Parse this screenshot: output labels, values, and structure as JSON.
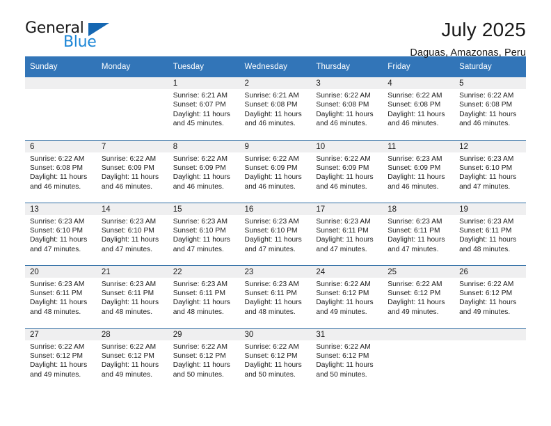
{
  "brand": {
    "name_part1": "General",
    "name_part2": "Blue",
    "triangle_color": "#1567b2",
    "blue_color": "#1a85d6"
  },
  "header": {
    "title": "July 2025",
    "location": "Daguas, Amazonas, Peru"
  },
  "theme": {
    "header_bg": "#3275b8",
    "row_divider": "#2e6da4",
    "num_band_bg": "#efeff0"
  },
  "weekday_headers": [
    "Sunday",
    "Monday",
    "Tuesday",
    "Wednesday",
    "Thursday",
    "Friday",
    "Saturday"
  ],
  "weeks": [
    [
      {
        "day": "",
        "sunrise": "",
        "sunset": "",
        "daylight1": "",
        "daylight2": ""
      },
      {
        "day": "",
        "sunrise": "",
        "sunset": "",
        "daylight1": "",
        "daylight2": ""
      },
      {
        "day": "1",
        "sunrise": "Sunrise: 6:21 AM",
        "sunset": "Sunset: 6:07 PM",
        "daylight1": "Daylight: 11 hours",
        "daylight2": "and 45 minutes."
      },
      {
        "day": "2",
        "sunrise": "Sunrise: 6:21 AM",
        "sunset": "Sunset: 6:08 PM",
        "daylight1": "Daylight: 11 hours",
        "daylight2": "and 46 minutes."
      },
      {
        "day": "3",
        "sunrise": "Sunrise: 6:22 AM",
        "sunset": "Sunset: 6:08 PM",
        "daylight1": "Daylight: 11 hours",
        "daylight2": "and 46 minutes."
      },
      {
        "day": "4",
        "sunrise": "Sunrise: 6:22 AM",
        "sunset": "Sunset: 6:08 PM",
        "daylight1": "Daylight: 11 hours",
        "daylight2": "and 46 minutes."
      },
      {
        "day": "5",
        "sunrise": "Sunrise: 6:22 AM",
        "sunset": "Sunset: 6:08 PM",
        "daylight1": "Daylight: 11 hours",
        "daylight2": "and 46 minutes."
      }
    ],
    [
      {
        "day": "6",
        "sunrise": "Sunrise: 6:22 AM",
        "sunset": "Sunset: 6:08 PM",
        "daylight1": "Daylight: 11 hours",
        "daylight2": "and 46 minutes."
      },
      {
        "day": "7",
        "sunrise": "Sunrise: 6:22 AM",
        "sunset": "Sunset: 6:09 PM",
        "daylight1": "Daylight: 11 hours",
        "daylight2": "and 46 minutes."
      },
      {
        "day": "8",
        "sunrise": "Sunrise: 6:22 AM",
        "sunset": "Sunset: 6:09 PM",
        "daylight1": "Daylight: 11 hours",
        "daylight2": "and 46 minutes."
      },
      {
        "day": "9",
        "sunrise": "Sunrise: 6:22 AM",
        "sunset": "Sunset: 6:09 PM",
        "daylight1": "Daylight: 11 hours",
        "daylight2": "and 46 minutes."
      },
      {
        "day": "10",
        "sunrise": "Sunrise: 6:22 AM",
        "sunset": "Sunset: 6:09 PM",
        "daylight1": "Daylight: 11 hours",
        "daylight2": "and 46 minutes."
      },
      {
        "day": "11",
        "sunrise": "Sunrise: 6:23 AM",
        "sunset": "Sunset: 6:09 PM",
        "daylight1": "Daylight: 11 hours",
        "daylight2": "and 46 minutes."
      },
      {
        "day": "12",
        "sunrise": "Sunrise: 6:23 AM",
        "sunset": "Sunset: 6:10 PM",
        "daylight1": "Daylight: 11 hours",
        "daylight2": "and 47 minutes."
      }
    ],
    [
      {
        "day": "13",
        "sunrise": "Sunrise: 6:23 AM",
        "sunset": "Sunset: 6:10 PM",
        "daylight1": "Daylight: 11 hours",
        "daylight2": "and 47 minutes."
      },
      {
        "day": "14",
        "sunrise": "Sunrise: 6:23 AM",
        "sunset": "Sunset: 6:10 PM",
        "daylight1": "Daylight: 11 hours",
        "daylight2": "and 47 minutes."
      },
      {
        "day": "15",
        "sunrise": "Sunrise: 6:23 AM",
        "sunset": "Sunset: 6:10 PM",
        "daylight1": "Daylight: 11 hours",
        "daylight2": "and 47 minutes."
      },
      {
        "day": "16",
        "sunrise": "Sunrise: 6:23 AM",
        "sunset": "Sunset: 6:10 PM",
        "daylight1": "Daylight: 11 hours",
        "daylight2": "and 47 minutes."
      },
      {
        "day": "17",
        "sunrise": "Sunrise: 6:23 AM",
        "sunset": "Sunset: 6:11 PM",
        "daylight1": "Daylight: 11 hours",
        "daylight2": "and 47 minutes."
      },
      {
        "day": "18",
        "sunrise": "Sunrise: 6:23 AM",
        "sunset": "Sunset: 6:11 PM",
        "daylight1": "Daylight: 11 hours",
        "daylight2": "and 47 minutes."
      },
      {
        "day": "19",
        "sunrise": "Sunrise: 6:23 AM",
        "sunset": "Sunset: 6:11 PM",
        "daylight1": "Daylight: 11 hours",
        "daylight2": "and 48 minutes."
      }
    ],
    [
      {
        "day": "20",
        "sunrise": "Sunrise: 6:23 AM",
        "sunset": "Sunset: 6:11 PM",
        "daylight1": "Daylight: 11 hours",
        "daylight2": "and 48 minutes."
      },
      {
        "day": "21",
        "sunrise": "Sunrise: 6:23 AM",
        "sunset": "Sunset: 6:11 PM",
        "daylight1": "Daylight: 11 hours",
        "daylight2": "and 48 minutes."
      },
      {
        "day": "22",
        "sunrise": "Sunrise: 6:23 AM",
        "sunset": "Sunset: 6:11 PM",
        "daylight1": "Daylight: 11 hours",
        "daylight2": "and 48 minutes."
      },
      {
        "day": "23",
        "sunrise": "Sunrise: 6:23 AM",
        "sunset": "Sunset: 6:11 PM",
        "daylight1": "Daylight: 11 hours",
        "daylight2": "and 48 minutes."
      },
      {
        "day": "24",
        "sunrise": "Sunrise: 6:22 AM",
        "sunset": "Sunset: 6:12 PM",
        "daylight1": "Daylight: 11 hours",
        "daylight2": "and 49 minutes."
      },
      {
        "day": "25",
        "sunrise": "Sunrise: 6:22 AM",
        "sunset": "Sunset: 6:12 PM",
        "daylight1": "Daylight: 11 hours",
        "daylight2": "and 49 minutes."
      },
      {
        "day": "26",
        "sunrise": "Sunrise: 6:22 AM",
        "sunset": "Sunset: 6:12 PM",
        "daylight1": "Daylight: 11 hours",
        "daylight2": "and 49 minutes."
      }
    ],
    [
      {
        "day": "27",
        "sunrise": "Sunrise: 6:22 AM",
        "sunset": "Sunset: 6:12 PM",
        "daylight1": "Daylight: 11 hours",
        "daylight2": "and 49 minutes."
      },
      {
        "day": "28",
        "sunrise": "Sunrise: 6:22 AM",
        "sunset": "Sunset: 6:12 PM",
        "daylight1": "Daylight: 11 hours",
        "daylight2": "and 49 minutes."
      },
      {
        "day": "29",
        "sunrise": "Sunrise: 6:22 AM",
        "sunset": "Sunset: 6:12 PM",
        "daylight1": "Daylight: 11 hours",
        "daylight2": "and 50 minutes."
      },
      {
        "day": "30",
        "sunrise": "Sunrise: 6:22 AM",
        "sunset": "Sunset: 6:12 PM",
        "daylight1": "Daylight: 11 hours",
        "daylight2": "and 50 minutes."
      },
      {
        "day": "31",
        "sunrise": "Sunrise: 6:22 AM",
        "sunset": "Sunset: 6:12 PM",
        "daylight1": "Daylight: 11 hours",
        "daylight2": "and 50 minutes."
      },
      {
        "day": "",
        "sunrise": "",
        "sunset": "",
        "daylight1": "",
        "daylight2": ""
      },
      {
        "day": "",
        "sunrise": "",
        "sunset": "",
        "daylight1": "",
        "daylight2": ""
      }
    ]
  ]
}
